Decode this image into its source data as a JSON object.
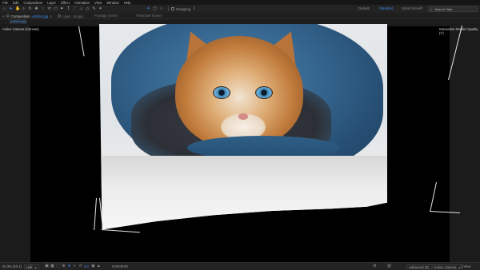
{
  "menu": [
    "File",
    "Edit",
    "Composition",
    "Layer",
    "Effect",
    "Animation",
    "View",
    "Window",
    "Help"
  ],
  "toolbar": {
    "tools": [
      "home-icon",
      "selection-icon",
      "hand-icon",
      "zoom-icon",
      "orbit-icon",
      "pan-icon",
      "dolly-icon",
      "rotate-icon",
      "camera-icon",
      "pen-icon",
      "type-icon",
      "brush-icon",
      "clone-stamp-icon",
      "eraser-icon",
      "roto-brush-icon",
      "puppet-pin-icon"
    ],
    "align_tools": [
      "axis-mode-icon",
      "rect-snap-icon",
      "circle-snap-icon"
    ],
    "checkbox_label": "",
    "snapping_label": "Snapping",
    "workspaces": [
      "Default",
      "Standard",
      "Small Screen"
    ],
    "active_workspace": "Standard",
    "more_label": "»",
    "search_placeholder": "Search Help"
  },
  "tabs": {
    "composition": {
      "prefix": "Composition",
      "name": "untitled.jpg",
      "active": true
    },
    "layer": {
      "prefix": "Layer",
      "name": "cat.jpg"
    },
    "footage": {
      "label": "Footage (none)"
    },
    "flowchart": {
      "label": "Flowchart (none)"
    }
  },
  "breadcrumb": "untitled.jpg",
  "viewer": {
    "left_label": "Active Camera (Canvas)",
    "right_label": "Interactive Render Quality (Y)"
  },
  "footer": {
    "zoom": "33.3% (50.1)",
    "resolution": "Half",
    "timecode": "0:00:00:00",
    "exposure": "0.0",
    "renderer": "Advanced 3D",
    "camera": "Active Camera",
    "view_layout": "1 View"
  },
  "colors": {
    "accent": "#3b8cf2",
    "panel": "#232323",
    "viewer_bg": "#000000"
  }
}
